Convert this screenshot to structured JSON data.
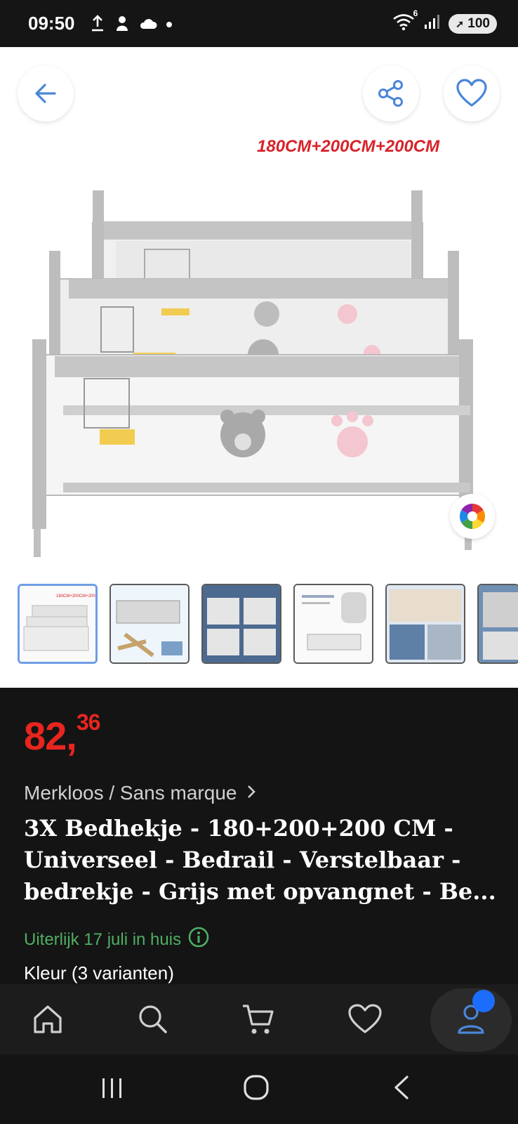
{
  "status_bar": {
    "time": "09:50",
    "signal_label": "6",
    "battery": "100"
  },
  "product_image": {
    "overlay_text": "180CM+200CM+200CM",
    "thumbnails_count": 6
  },
  "product": {
    "price_main": "82,",
    "price_cents": "36",
    "brand": "Merkloos / Sans marque",
    "title": "3X Bedhekje - 180+200+200 CM - Universeel - Bedrail - Verstelbaar - bedrekje - Grijs met opvangnet - Be...",
    "delivery": "Uiterlijk 17 juli in huis",
    "variants": "Kleur (3 varianten)"
  },
  "nav": {
    "items": [
      "home",
      "search",
      "cart",
      "favorites",
      "account"
    ]
  },
  "colors": {
    "price": "#e8251f",
    "delivery": "#4fae62",
    "accent": "#1c6dfc",
    "icon_blue": "#4a86d8"
  }
}
